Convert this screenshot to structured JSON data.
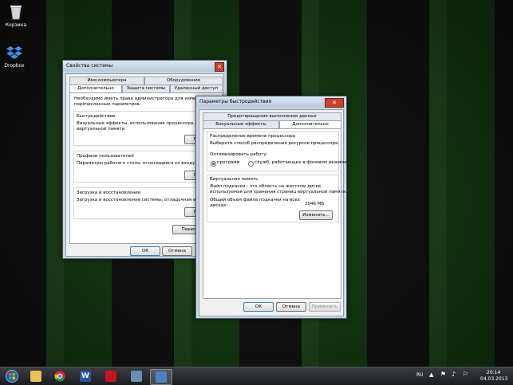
{
  "desktop": {
    "icons": [
      {
        "label": "Корзина",
        "icon": "recycle-bin-icon"
      },
      {
        "label": "Dropbox",
        "icon": "dropbox-icon"
      }
    ]
  },
  "sysprops": {
    "title": "Свойства системы",
    "tabs_row1": [
      "Имя компьютера",
      "Оборудование"
    ],
    "tabs_row2": [
      "Дополнительно",
      "Защита системы",
      "Удаленный доступ"
    ],
    "intro": [
      "Необходимо иметь права администратора для изменения б",
      "перечисленных параметров."
    ],
    "perf": {
      "title": "Быстродействие",
      "lines": [
        "Визуальные эффекты, использование процессора, операт",
        "виртуальной памяти"
      ],
      "button": "Парам"
    },
    "profiles": {
      "title": "Профили пользователей",
      "lines": [
        "Параметры рабочего стола, относящиеся ко входу в систе"
      ],
      "button": "Парам"
    },
    "startup": {
      "title": "Загрузка и восстановление",
      "lines": [
        "Загрузка и восстановление системы, отладочная информ"
      ],
      "button": "Парам"
    },
    "env_button": "Переменные",
    "ok": "ОК",
    "cancel": "Отмена"
  },
  "perfopts": {
    "title": "Параметры быстродействия",
    "tab_top": "Предотвращение выполнения данных",
    "tabs": [
      "Визуальные эффекты",
      "Дополнительно"
    ],
    "cpu": {
      "title": "Распределение времени процессора",
      "desc": "Выберите способ распределения ресурсов процессора.",
      "optimize": "Оптимизировать работу:",
      "options": [
        "программ",
        "служб, работающих в фоновом режиме"
      ]
    },
    "vm": {
      "title": "Виртуальная память",
      "desc": [
        "Файл подкачки - это область на жестком диске,",
        "используемая для хранения страниц виртуальной памяти."
      ],
      "total_label": [
        "Общий объем файла подкачки на всех",
        "дисках:"
      ],
      "total_value": "2046 МБ",
      "change_button": "Изменить..."
    },
    "ok": "ОК",
    "cancel": "Отмена",
    "apply": "Применить"
  },
  "taskbar": {
    "items": [
      "start-orb-icon",
      "explorer-icon",
      "chrome-icon",
      "word-icon",
      "pdf-icon",
      "remote-desktop-icon",
      "system-properties-icon"
    ],
    "lang": "RU",
    "time": "20:14",
    "date": "04.03.2013"
  }
}
